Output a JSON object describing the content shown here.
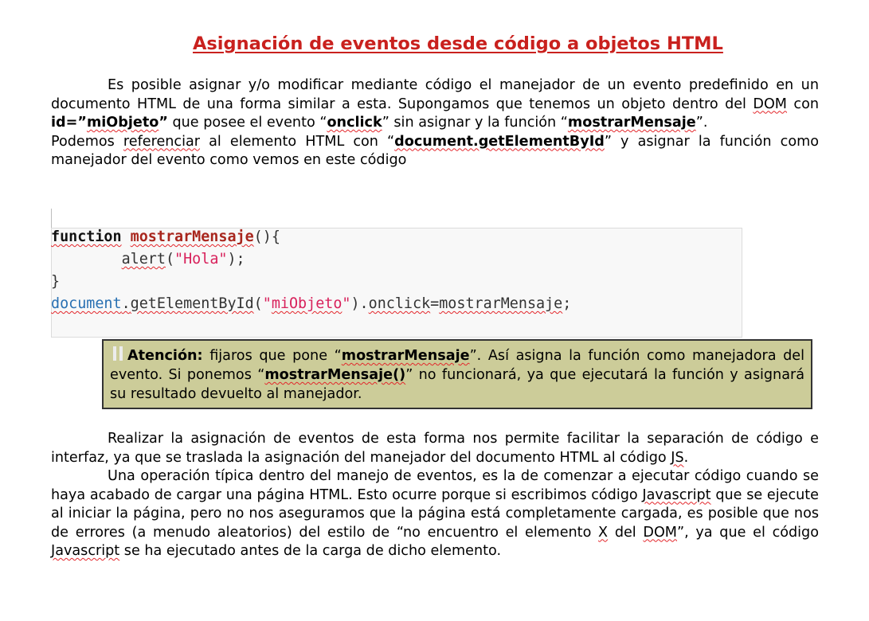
{
  "title": "Asignación de eventos desde código a objetos HTML",
  "paragraph1": {
    "t1": "Es posible asignar y/o modificar mediante código el manejador de un evento predefinido en un documento HTML de una forma similar a esta. Supongamos que tenemos un objeto dentro del ",
    "dom": "DOM",
    "t2": " con ",
    "id_attr": "id=”",
    "id_value": "miObjeto",
    "id_close": "”",
    "t3": " que posee el evento “",
    "onclick": "onclick",
    "t4": "” sin asignar y la función “",
    "func": "mostrarMensaje",
    "t5": "”."
  },
  "paragraph2": {
    "t1": "Podemos ",
    "ref": "referenciar",
    "t2": " al elemento HTML con “",
    "method": "document.getElementById",
    "t3": "” y asignar la función como manejador del evento como vemos en este código"
  },
  "code": {
    "line1_kw": "function",
    "line1_name": "mostrarMensaje",
    "line1_rest": "(){",
    "line2_indent": "        ",
    "line2_call": "alert",
    "line2_paren_open": "(",
    "line2_str": "\"Hola\"",
    "line2_end": ");",
    "line3": "}",
    "line4_obj": "document",
    "line4_dot": ".",
    "line4_method": "getElementById",
    "line4_paren": "(",
    "line4_str_q1": "\"",
    "line4_str_val": "miObjeto",
    "line4_str_q2": "\"",
    "line4_mid": ").",
    "line4_prop": "onclick",
    "line4_eq": "=",
    "line4_val": "mostrarMensaje",
    "line4_end": ";"
  },
  "note": {
    "label": "Atención:",
    "t1": " fijaros que pone “",
    "func": "mostrarMensaje",
    "t2": "”. Así asigna la función como manejadora del evento. Si ponemos “",
    "func_call": "mostrarMensaje()",
    "t3": "” no funcionará, ya que ejecutará la función y asignará su resultado devuelto al manejador."
  },
  "paragraph3": {
    "t1": "Realizar la asignación de eventos de esta forma nos permite facilitar la separación de código e interfaz, ya que se traslada la asignación del manejador del documento HTML al código ",
    "js": "JS",
    "t2": "."
  },
  "paragraph4": {
    "t1": "Una operación típica dentro del manejo de eventos, es la de comenzar a ejecutar código cuando se haya acabado de cargar una página HTML. Esto ocurre porque si escribimos código ",
    "js1": "Javascript",
    "t2": " que se ejecute al iniciar la página, pero no nos aseguramos que la página está completamente cargada, es posible que nos de errores (a menudo aleatorios) del estilo de “no encuentro el elemento ",
    "x": "X",
    "t3": " del ",
    "dom": "DOM",
    "t4": "”, ya que el código ",
    "js2": "Javascript",
    "t5": " se ha ejecutado antes de la carga de dicho elemento."
  }
}
